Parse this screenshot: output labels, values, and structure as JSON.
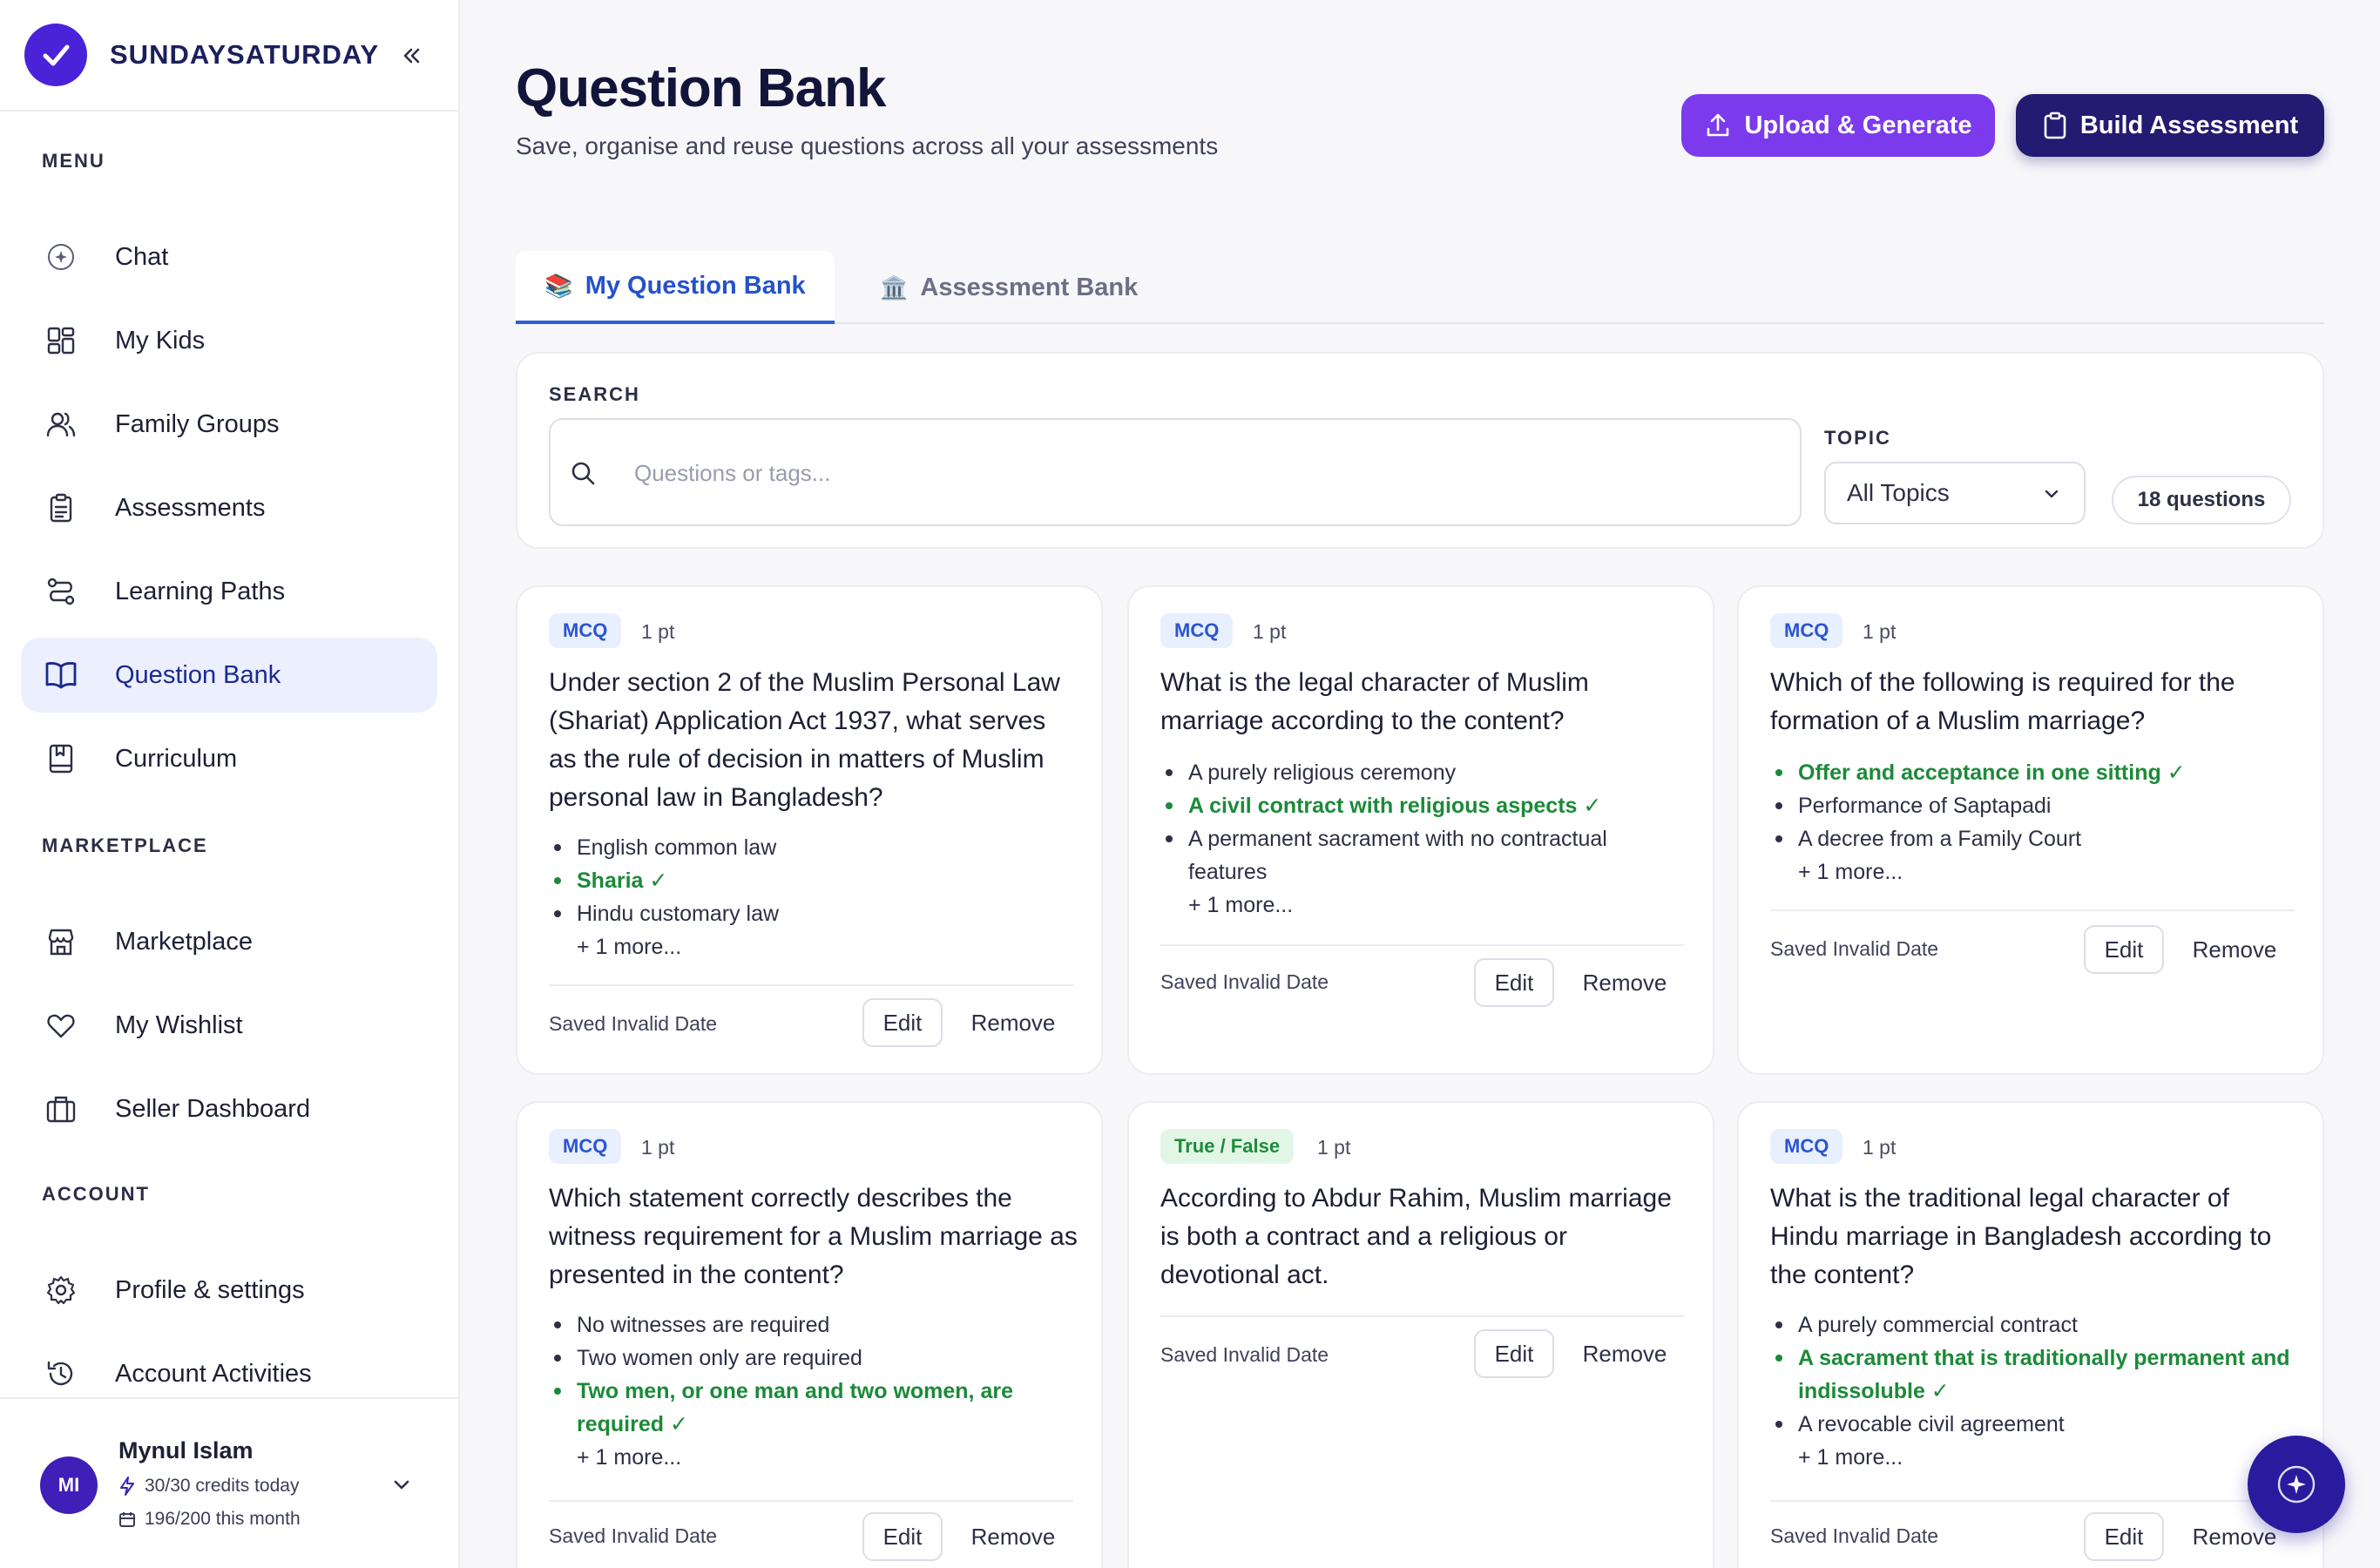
{
  "app": {
    "brand": "SUNDAYSATURDAY"
  },
  "sidebar": {
    "menu_label": "MENU",
    "marketplace_label": "MARKETPLACE",
    "account_label": "ACCOUNT",
    "menu": [
      {
        "label": "Chat",
        "icon": "chat-spark-icon"
      },
      {
        "label": "My Kids",
        "icon": "grid-icon"
      },
      {
        "label": "Family Groups",
        "icon": "users-icon"
      },
      {
        "label": "Assessments",
        "icon": "clipboard-icon"
      },
      {
        "label": "Learning Paths",
        "icon": "route-icon"
      },
      {
        "label": "Question Bank",
        "icon": "book-open-icon",
        "active": true
      },
      {
        "label": "Curriculum",
        "icon": "notebook-icon"
      }
    ],
    "marketplace": [
      {
        "label": "Marketplace",
        "icon": "store-icon"
      },
      {
        "label": "My Wishlist",
        "icon": "heart-icon"
      },
      {
        "label": "Seller Dashboard",
        "icon": "briefcase-icon"
      }
    ],
    "account": [
      {
        "label": "Profile & settings",
        "icon": "gear-icon"
      },
      {
        "label": "Account Activities",
        "icon": "history-icon"
      }
    ],
    "user": {
      "initials": "MI",
      "name": "Mynul Islam",
      "credits_today": "30/30 credits today",
      "credits_month": "196/200 this month"
    }
  },
  "header": {
    "title": "Question Bank",
    "subtitle": "Save, organise and reuse questions across all your assessments",
    "upload_label": "Upload & Generate",
    "build_label": "Build Assessment"
  },
  "tabs": [
    {
      "label": "My Question Bank",
      "emoji": "📚",
      "active": true
    },
    {
      "label": "Assessment Bank",
      "emoji": "🏛️",
      "active": false
    }
  ],
  "filters": {
    "search_label": "SEARCH",
    "search_placeholder": "Questions or tags...",
    "search_value": "",
    "topic_label": "TOPIC",
    "topic_value": "All Topics",
    "count": "18 questions"
  },
  "cards": [
    {
      "type": "MCQ",
      "points": "1 pt",
      "question": "Under section 2 of the Muslim Personal Law (Shariat) Application Act 1937, what serves as the rule of decision in matters of Muslim personal law in Bangladesh?",
      "options": [
        {
          "text": "English common law",
          "correct": false
        },
        {
          "text": "Sharia ✓",
          "correct": true
        },
        {
          "text": "Hindu customary law",
          "correct": false
        }
      ],
      "more": "+ 1 more...",
      "saved": "Saved Invalid Date",
      "edit": "Edit",
      "remove": "Remove"
    },
    {
      "type": "MCQ",
      "points": "1 pt",
      "question": "What is the legal character of Muslim marriage according to the content?",
      "options": [
        {
          "text": "A purely religious ceremony",
          "correct": false
        },
        {
          "text": "A civil contract with religious aspects ✓",
          "correct": true
        },
        {
          "text": "A permanent sacrament with no contractual features",
          "correct": false
        }
      ],
      "more": "+ 1 more...",
      "saved": "Saved Invalid Date",
      "edit": "Edit",
      "remove": "Remove"
    },
    {
      "type": "MCQ",
      "points": "1 pt",
      "question": "Which of the following is required for the formation of a Muslim marriage?",
      "options": [
        {
          "text": "Offer and acceptance in one sitting ✓",
          "correct": true
        },
        {
          "text": "Performance of Saptapadi",
          "correct": false
        },
        {
          "text": "A decree from a Family Court",
          "correct": false
        }
      ],
      "more": "+ 1 more...",
      "saved": "Saved Invalid Date",
      "edit": "Edit",
      "remove": "Remove"
    },
    {
      "type": "MCQ",
      "points": "1 pt",
      "question": "Which statement correctly describes the witness requirement for a Muslim marriage as presented in the content?",
      "options": [
        {
          "text": "No witnesses are required",
          "correct": false
        },
        {
          "text": "Two women only are required",
          "correct": false
        },
        {
          "text": "Two men, or one man and two women, are required ✓",
          "correct": true
        }
      ],
      "more": "+ 1 more...",
      "saved": "Saved Invalid Date",
      "edit": "Edit",
      "remove": "Remove"
    },
    {
      "type": "True / False",
      "points": "1 pt",
      "question": "According to Abdur Rahim, Muslim marriage is both a contract and a religious or devotional act.",
      "options": [],
      "more": "",
      "saved": "Saved Invalid Date",
      "edit": "Edit",
      "remove": "Remove"
    },
    {
      "type": "MCQ",
      "points": "1 pt",
      "question": "What is the traditional legal character of Hindu marriage in Bangladesh according to the content?",
      "options": [
        {
          "text": "A purely commercial contract",
          "correct": false
        },
        {
          "text": "A sacrament that is traditionally permanent and indissoluble ✓",
          "correct": true
        },
        {
          "text": "A revocable civil agreement",
          "correct": false
        }
      ],
      "more": "+ 1 more...",
      "saved": "Saved Invalid Date",
      "edit": "Edit",
      "remove": "Remove"
    }
  ],
  "colors": {
    "accent": "#4a23d8",
    "upload": "#7c3aed",
    "build": "#231a72",
    "correct": "#1c8a39"
  }
}
